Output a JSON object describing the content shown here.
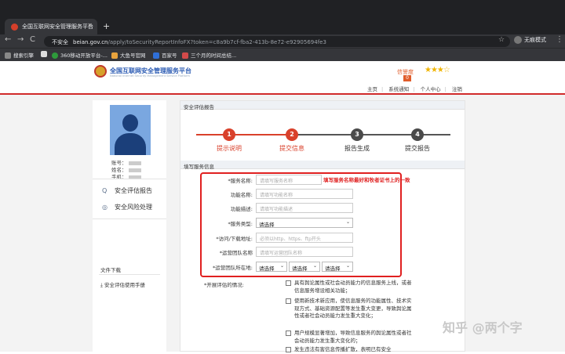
{
  "browser": {
    "tab_title": "全国互联网安全管理服务平台",
    "tab_close": "✕",
    "new_tab": "+",
    "back": "←",
    "forward": "→",
    "reload": "C",
    "security_label": "不安全",
    "url_host": "beian.gov.cn",
    "url_path": "/apply/toSecurityReportInfoFX?token=c8a9b7cf-fba2-413b-8e72-e92905694fe3",
    "bookmark_star": "☆",
    "profile_label": "无痕模式",
    "menu": "⋮",
    "bookmarks": [
      "搜索引擎",
      "360移动开放平台-...",
      "大鱼号官网",
      "百家号",
      "三个月的时间总结..."
    ],
    "icon_colors": {
      "search": "#888888",
      "mobile360": "#2e9a3b",
      "dayu": "#e8a33d",
      "baijia": "#2f6fd6",
      "blog": "#d24a4a"
    }
  },
  "header": {
    "site_title": "全国互联网安全管理服务平台",
    "site_subtitle": "National Internet Security Management Service Platform",
    "rating_label": "信誉度",
    "rating_value": "0",
    "stars": "★★★☆",
    "nav": [
      "主页",
      "系统通知",
      "个人中心",
      "注销"
    ],
    "accent_color": "#d12b2b"
  },
  "sidebar": {
    "account_label": "账号：",
    "name_label": "姓名：",
    "phone_label": "手机：",
    "menu": [
      {
        "label": "安全评估报告",
        "icon": "search-icon",
        "glyph": "Q"
      },
      {
        "label": "安全风险处理",
        "icon": "shield-icon",
        "glyph": "◎"
      }
    ],
    "file_header": "文件下载",
    "file_item": "安全评估使用手册",
    "file_icon": "⤓"
  },
  "main": {
    "section_title": "安全评估报告",
    "steps": [
      {
        "num": "1",
        "label": "提示说明",
        "state": "done"
      },
      {
        "num": "2",
        "label": "提交信息",
        "state": "active"
      },
      {
        "num": "3",
        "label": "报告生成",
        "state": "todo"
      },
      {
        "num": "4",
        "label": "提交报告",
        "state": "todo"
      }
    ],
    "step_colors": {
      "done": "#d9412b",
      "todo": "#4a4a4a",
      "done_text": "#d9412b",
      "todo_text": "#333333"
    },
    "form_section_title": "填写服务信息",
    "annotation": "填写服务名称最好和牧者证书上的一致",
    "form": {
      "service_name_label": "*服务名称:",
      "service_name_placeholder": "请填写服务名称",
      "func_name_label": "功能名称:",
      "func_name_placeholder": "请填写功能名称",
      "func_desc_label": "功能描述:",
      "func_desc_placeholder": "请填写功能描述",
      "service_type_label": "*服务类型:",
      "service_type_value": "请选择",
      "url_label": "*访问/下载地址:",
      "url_placeholder": "必须以http、https、ftp开头",
      "team_name_label": "*运营团队名称",
      "team_name_placeholder": "请填写运营团队名称",
      "team_location_label": "*运营团队所在地:",
      "location_selects": [
        "请选择",
        "请选择",
        "请选择"
      ]
    },
    "checkbox_label": "*开展评估的情况:",
    "checkbox_items": [
      "具有舆论属性或社会动员能力的信息服务上线，或者信息服务增设相关功能；",
      "使用新技术新应用，使信息服务的功能属性、技术实现方式、基础资源配置等发生重大变更，导致舆论属性或者社会动员能力发生重大变化；",
      "用户规模显著增加，导致信息服务的舆论属性或者社会动员能力发生重大变化的；",
      "发生违法有害信息传播扩散，表明已有安全"
    ]
  },
  "watermark": "知乎 @两个字"
}
